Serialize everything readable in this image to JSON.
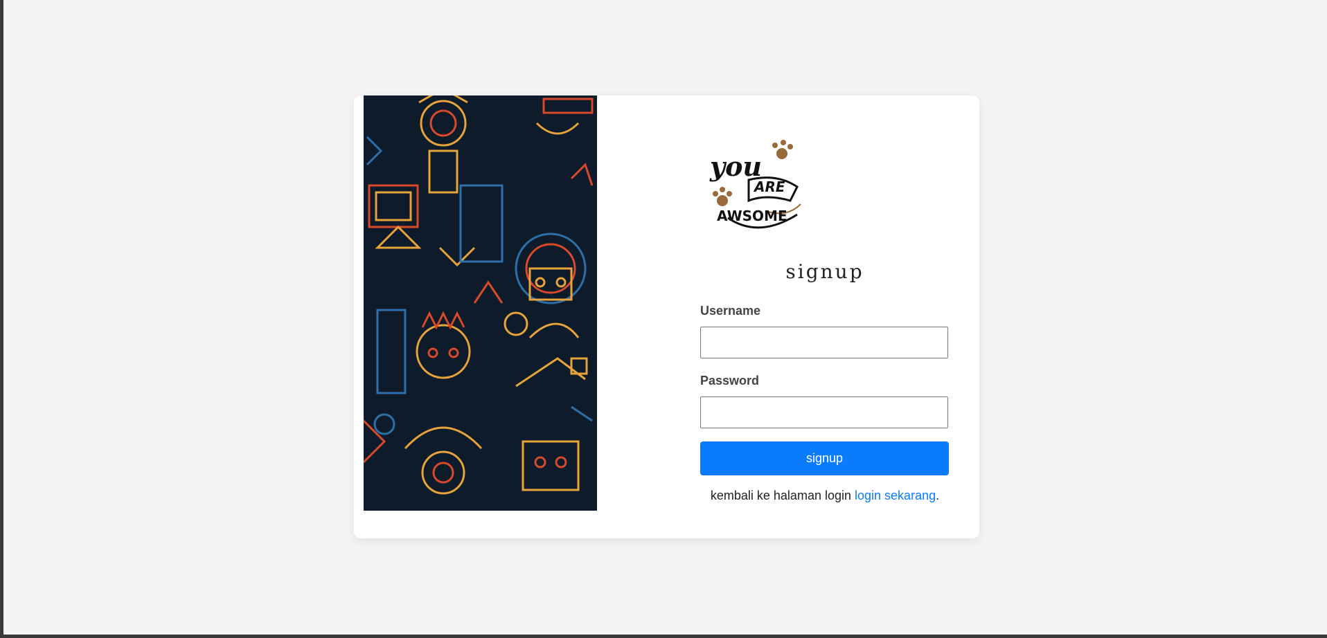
{
  "form": {
    "title": "signup",
    "username_label": "Username",
    "username_value": "",
    "password_label": "Password",
    "password_value": "",
    "submit_label": "signup"
  },
  "logo": {
    "text_top": "you",
    "text_middle": "ARE",
    "text_bottom": "AWSOME"
  },
  "footer": {
    "prefix": "kembali ke halaman login",
    "link_label": "login sekarang",
    "suffix": "."
  },
  "colors": {
    "page_bg": "#f4f4f4",
    "card_bg": "#ffffff",
    "accent": "#0a7bfb",
    "art_bg": "#0d1b2a",
    "paw": "#9a6a3a"
  }
}
